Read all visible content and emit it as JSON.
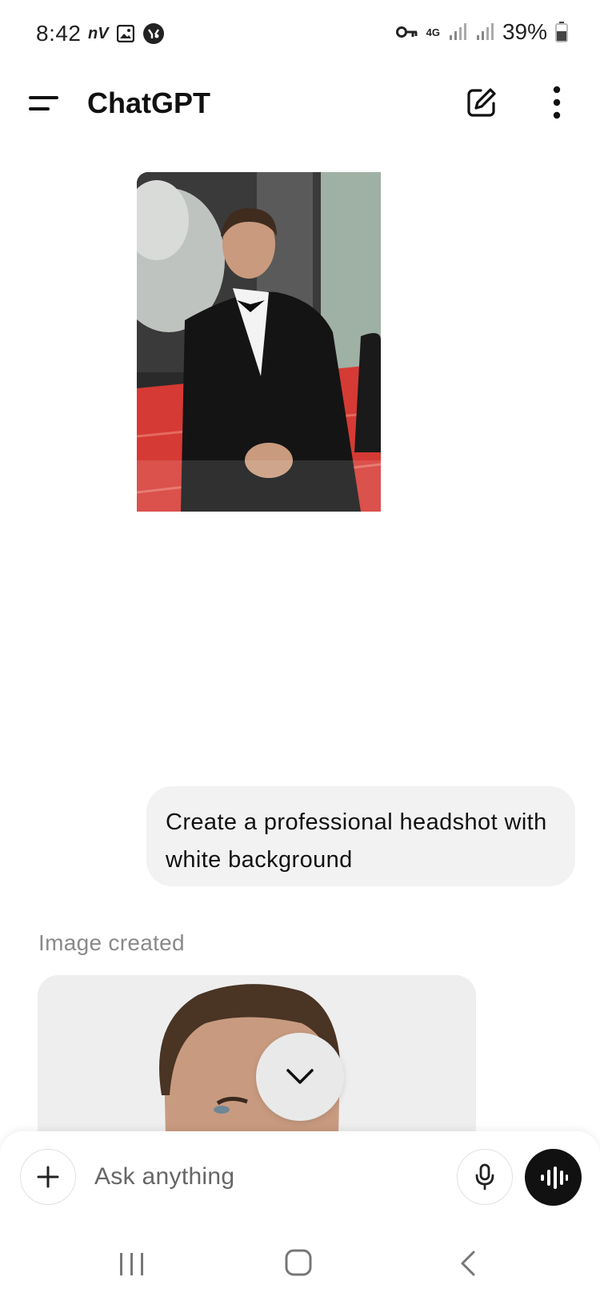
{
  "status_bar": {
    "time": "8:42",
    "nv_label": "nV",
    "network": "4G",
    "battery": "39%"
  },
  "header": {
    "title": "ChatGPT"
  },
  "conversation": {
    "user_message": "Create a professional headshot with white background",
    "assistant_label": "Image created"
  },
  "composer": {
    "placeholder": "Ask anything"
  },
  "icons": {
    "menu": "menu-icon",
    "new_chat": "edit-icon",
    "more": "more-vertical-icon",
    "scroll_down": "chevron-down-icon",
    "attach": "plus-icon",
    "mic": "microphone-icon",
    "voice": "voice-waveform-icon"
  },
  "colors": {
    "bubble": "#f2f2f2",
    "voice_button": "#111111",
    "muted_text": "#8a8a8a",
    "red_carpet": "#d63a34"
  }
}
